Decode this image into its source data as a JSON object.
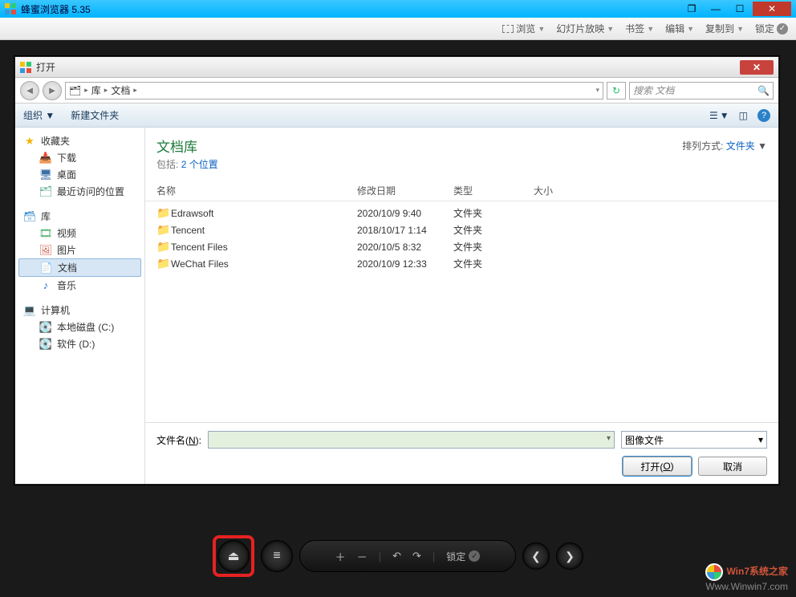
{
  "app": {
    "title": "蜂蜜浏览器 5.35"
  },
  "menubar": {
    "view": "浏览",
    "slideshow": "幻灯片放映",
    "bookmark": "书签",
    "edit": "编辑",
    "copyto": "复制到",
    "lock": "锁定"
  },
  "dialog": {
    "title": "打开",
    "breadcrumb": {
      "root": "库",
      "current": "文档"
    },
    "search_placeholder": "搜索 文档",
    "toolbar": {
      "organize": "组织",
      "newfolder": "新建文件夹"
    },
    "tree": {
      "favorites": "收藏夹",
      "downloads": "下载",
      "desktop": "桌面",
      "recent": "最近访问的位置",
      "library": "库",
      "video": "视频",
      "pictures": "图片",
      "documents": "文档",
      "music": "音乐",
      "computer": "计算机",
      "drive_c": "本地磁盘 (C:)",
      "drive_d": "软件 (D:)"
    },
    "library_header": {
      "title": "文档库",
      "includes_label": "包括:",
      "includes_link": "2 个位置",
      "sort_label": "排列方式:",
      "sort_value": "文件夹"
    },
    "columns": {
      "name": "名称",
      "date": "修改日期",
      "type": "类型",
      "size": "大小"
    },
    "rows": [
      {
        "name": "Edrawsoft",
        "date": "2020/10/9 9:40",
        "type": "文件夹"
      },
      {
        "name": "Tencent",
        "date": "2018/10/17 1:14",
        "type": "文件夹"
      },
      {
        "name": "Tencent Files",
        "date": "2020/10/5 8:32",
        "type": "文件夹"
      },
      {
        "name": "WeChat Files",
        "date": "2020/10/9 12:33",
        "type": "文件夹"
      }
    ],
    "footer": {
      "filename_label_pre": "文件名(",
      "filename_label_u": "N",
      "filename_label_post": "):",
      "filter": "图像文件",
      "open_pre": "打开(",
      "open_u": "O",
      "open_post": ")",
      "cancel": "取消"
    }
  },
  "player": {
    "lock": "锁定"
  },
  "watermark": {
    "brand": "Win7系统之家",
    "url": "Www.Winwin7.com"
  }
}
